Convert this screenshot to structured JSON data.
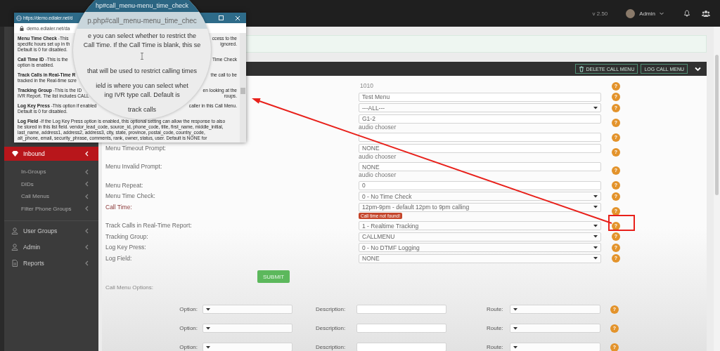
{
  "top_bar": {
    "version": "v 2.50",
    "user": "Admin"
  },
  "sidebar": {
    "items": [
      {
        "label": "Inbound",
        "selected": true,
        "children": [
          {
            "label": "In-Groups",
            "selected": false
          },
          {
            "label": "DIDs",
            "selected": false
          },
          {
            "label": "Call Menus",
            "selected": false
          },
          {
            "label": "Filter Phone Groups",
            "selected": false
          }
        ]
      },
      {
        "label": "User Groups",
        "selected": false
      },
      {
        "label": "Admin",
        "selected": false
      },
      {
        "label": "Reports",
        "selected": false
      }
    ]
  },
  "panel": {
    "buttons": [
      {
        "label": "DELETE CALL MENU"
      },
      {
        "label": "LOG CALL MENU"
      }
    ],
    "rows": [
      {
        "kind": "static",
        "value": "1010",
        "help": "?"
      },
      {
        "kind": "text",
        "value": "Test Menu",
        "help": "?"
      },
      {
        "kind": "select",
        "value": "---ALL---",
        "help": "?"
      },
      {
        "kind": "text",
        "value": "G1-2",
        "note": "audio chooser",
        "help": "?"
      },
      {
        "kind": "text",
        "help": "?"
      },
      {
        "label": "Menu Timeout Prompt:",
        "kind": "text",
        "value": "NONE",
        "note": "audio chooser",
        "help": "?"
      },
      {
        "label": "Menu Invalid Prompt:",
        "kind": "text",
        "value": "NONE",
        "note": "audio chooser",
        "help": "?"
      },
      {
        "label": "Menu Repeat:",
        "kind": "text",
        "value": "0",
        "help": "?"
      },
      {
        "label": "Menu Time Check:",
        "kind": "select",
        "value": "0 - No Time Check",
        "help": "?"
      },
      {
        "label": "Call Time:",
        "kind": "select",
        "value": "12pm-9pm - default 12pm to 9pm calling",
        "error": "Call time not found!",
        "help": "?"
      },
      {
        "label": "Track Calls in Real-Time Report:",
        "kind": "select",
        "value": "1 - Realtime Tracking",
        "help": "?"
      },
      {
        "label": "Tracking Group:",
        "kind": "select",
        "value": "CALLMENU",
        "help": "?"
      },
      {
        "label": "Log Key Press:",
        "kind": "select",
        "value": "0 - No DTMF Logging",
        "help": "?"
      },
      {
        "label": "Log Field:",
        "kind": "select",
        "value": "NONE",
        "help": "?"
      }
    ],
    "submit": "SUBMIT",
    "options_title": "Call Menu Options:",
    "option_rows": [
      {
        "option_label": "Option:",
        "description_label": "Description:",
        "route_label": "Route:",
        "help": "?"
      },
      {
        "option_label": "Option:",
        "description_label": "Description:",
        "route_label": "Route:",
        "help": "?"
      },
      {
        "option_label": "Option:",
        "description_label": "Description:",
        "route_label": "Route:",
        "help": "?"
      }
    ]
  },
  "help_popup": {
    "title": "https://demo.edialer.net/d",
    "address": "demo.edialer.net/da",
    "entries": [
      {
        "lines": [
          {
            "left": "**Menu Time Check** -This",
            "right": "ccess to the"
          },
          {
            "left": "specific hours set up in th",
            "right": "ignored."
          },
          {
            "left": "Default is 0 for disabled."
          }
        ]
      },
      {
        "lines": [
          {
            "left": "**Call Time ID** -This is the",
            "right": "Time Check"
          },
          {
            "left": "option is enabled."
          }
        ]
      },
      {
        "lines": [
          {
            "left": "**Track Calls in Real-Time R**",
            "right": "the call to be"
          },
          {
            "left": "tracked in the Real-time scre"
          }
        ]
      },
      {
        "lines": [
          {
            "left": "**Tracking Group** -This is the ID",
            "right": "en looking at the"
          },
          {
            "left": "IVR Report. The list includes CALL",
            "right": "roups."
          }
        ]
      },
      {
        "lines": [
          {
            "left": "**Log Key Press** -This option if enabled",
            "right": "caller in this Call Menu."
          },
          {
            "left": "Default is 0 for disabled."
          }
        ]
      },
      {
        "lines": [
          {
            "left": "**Log Field** -If the Log Key Press option is enabled, this optional setting can allow the response to also"
          },
          {
            "left": "be stored in this list field. vendor_lead_code, source_id, phone_code, title, first_name, middle_initial,"
          },
          {
            "left": "last_name, address1, address2, address3, city, state, province, postal_code, country_code,"
          },
          {
            "left": "alt_phone, email, security_phrase, comments, rank, owner, status, user. Default is NONE for"
          }
        ]
      }
    ]
  },
  "magnifier": {
    "title": "hp#call_menu-menu_time_check",
    "address": "p.php#call_menu-menu_time_chec",
    "paragraphs": [
      [
        "e you can select whether to restrict the",
        "Call Time. If the Call Time is blank, this se"
      ],
      [
        "that will be used to restrict calling times"
      ],
      [
        "ield is where you can select whet",
        "ing IVR type call. Default is"
      ],
      [
        "track calls"
      ]
    ]
  },
  "annotation": {
    "arrow": true,
    "highlight_box": true
  }
}
